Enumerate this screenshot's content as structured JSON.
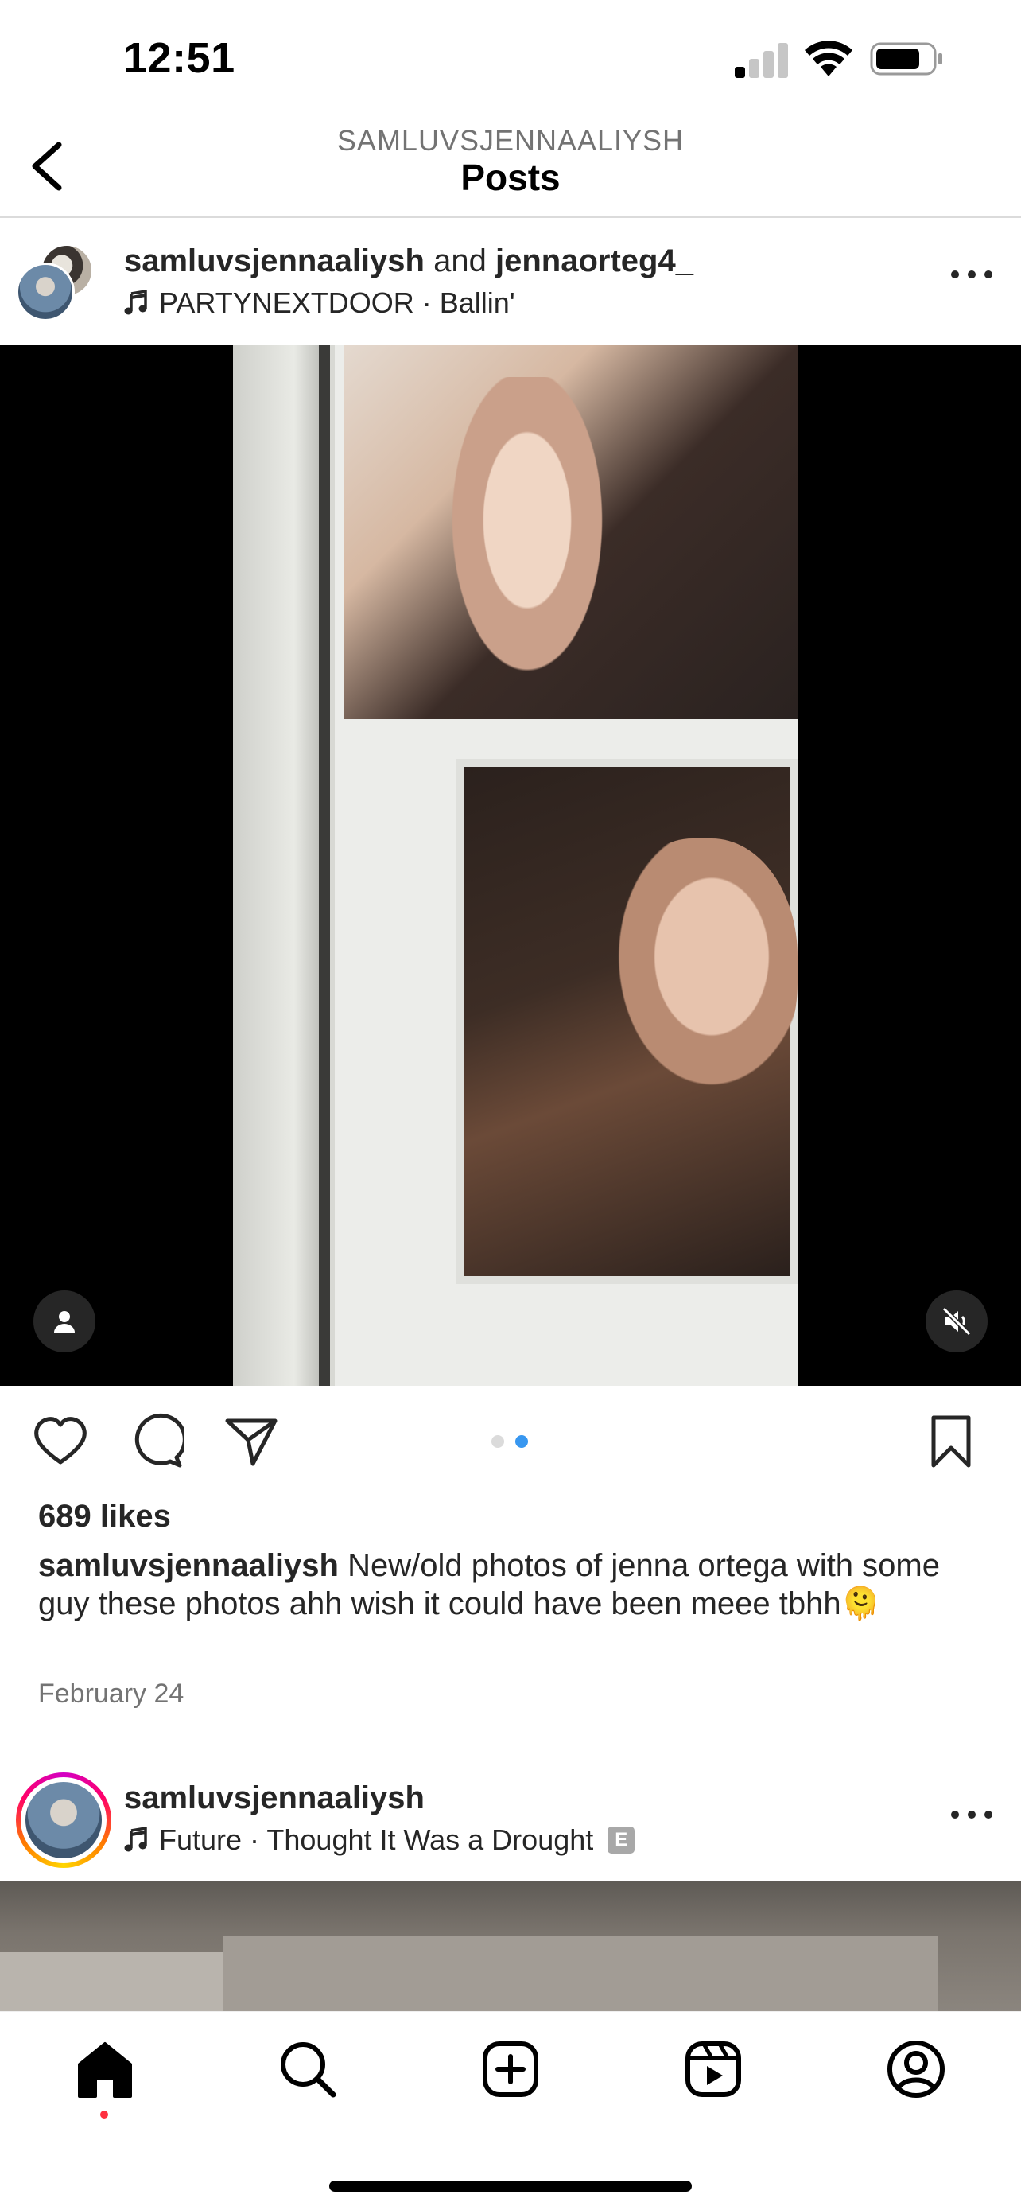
{
  "status_bar": {
    "time": "12:51"
  },
  "nav": {
    "username": "SAMLUVSJENNAALIYSH",
    "title": "Posts"
  },
  "post1": {
    "author": "samluvsjennaaliysh",
    "connector": "and",
    "coauthor": "jennaorteg4_",
    "music": "PARTYNEXTDOOR · Ballin'",
    "likes": "689 likes",
    "caption_user": "samluvsjennaaliysh",
    "caption_text": "New/old photos of jenna ortega with some guy these photos ahh wish it could have been meee tbhh🫠",
    "date": "February 24",
    "carousel": {
      "total": 2,
      "current": 2
    }
  },
  "post2": {
    "author": "samluvsjennaaliysh",
    "music": "Future · Thought It Was a Drought",
    "explicit_badge": "E"
  },
  "icons": {
    "back": "chevron-left-icon",
    "music": "music-note-icon",
    "more": "more-horizontal-icon",
    "user_tag": "person-icon",
    "mute": "speaker-muted-icon",
    "like": "heart-icon",
    "comment": "comment-icon",
    "share": "paper-plane-icon",
    "save": "bookmark-icon",
    "home": "home-icon",
    "search": "search-icon",
    "create": "plus-square-icon",
    "reels": "reels-icon",
    "profile": "profile-icon"
  },
  "colors": {
    "carousel_active": "#3897f0",
    "carousel_inactive": "#dbdbdb",
    "notification_dot": "#ff3040"
  }
}
